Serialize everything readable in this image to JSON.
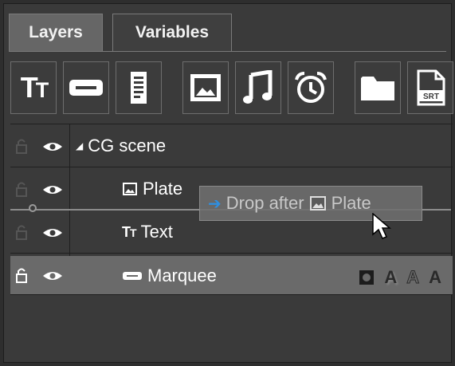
{
  "tabs": [
    {
      "label": "Layers",
      "active": true
    },
    {
      "label": "Variables",
      "active": false
    }
  ],
  "toolbar": {
    "buttons": [
      {
        "icon": "text-icon",
        "glyph": "TT"
      },
      {
        "icon": "marquee-icon"
      },
      {
        "icon": "document-icon"
      },
      {
        "icon": "image-icon"
      },
      {
        "icon": "music-note-icon"
      },
      {
        "icon": "alarm-clock-icon"
      },
      {
        "icon": "folder-icon"
      },
      {
        "icon": "srt-file-icon",
        "glyph": "SRT"
      }
    ]
  },
  "layers": [
    {
      "name": "CG scene",
      "icon": "caret-down-icon",
      "caret": "◢",
      "selected": false
    },
    {
      "name": "Plate",
      "icon": "image-icon",
      "selected": false
    },
    {
      "name": "Text",
      "icon": "text-icon",
      "glyph": "TT",
      "selected": false
    },
    {
      "name": "Marquee",
      "icon": "marquee-icon",
      "selected": true
    }
  ],
  "drag_tooltip": {
    "prefix": "Drop after",
    "target": "Plate",
    "arrow": "➔"
  },
  "marquee_flags": [
    "A",
    "A",
    "A"
  ],
  "colors": {
    "background": "#3a3a3a",
    "selected_row": "#6a6a6a",
    "accent_arrow": "#2f8fe0"
  }
}
